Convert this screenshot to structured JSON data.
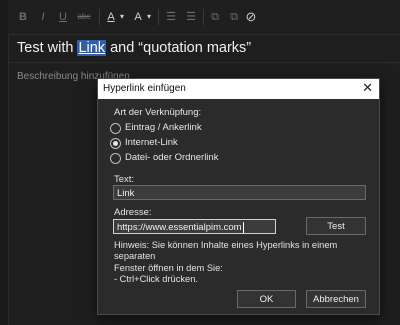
{
  "toolbar": {
    "bold": "B",
    "italic": "I",
    "underline": "U",
    "strike": "abc",
    "font_color_icon": "A",
    "highlight_icon": "A",
    "caret": "▾",
    "bullets_icon": "☰",
    "numbers_icon": "☰",
    "link_icon": "⧉",
    "attach_icon": "⊘"
  },
  "note": {
    "title_before": "Test with ",
    "title_link": "Link",
    "title_after": " and “quotation marks”",
    "description_placeholder": "Beschreibung hinzufügen"
  },
  "dialog": {
    "title": "Hyperlink einfügen",
    "close": "✕",
    "link_type_label": "Art der Verknüpfung:",
    "options": [
      {
        "label": "Eintrag / Ankerlink",
        "selected": false
      },
      {
        "label": "Internet-Link",
        "selected": true
      },
      {
        "label": "Datei- oder Ordnerlink",
        "selected": false
      }
    ],
    "text_label": "Text:",
    "text_value": "Link",
    "address_label": "Adresse:",
    "address_value": "https://www.essentialpim.com",
    "test_button": "Test",
    "hint_line1": "Hinweis: Sie können Inhalte eines Hyperlinks in einem separaten",
    "hint_line2": "Fenster öffnen in dem Sie:",
    "hint_line3": " - Ctrl+Click drücken.",
    "ok_button": "OK",
    "cancel_button": "Abbrechen"
  }
}
